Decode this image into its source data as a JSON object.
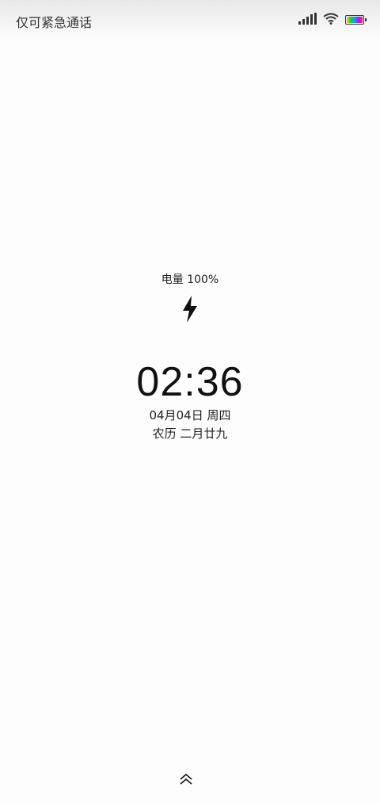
{
  "status_bar": {
    "carrier_text": "仅可紧急通话",
    "icons": [
      "signal-icon",
      "wifi-icon",
      "battery-icon"
    ]
  },
  "lock_screen": {
    "charge_text": "电量 100%",
    "charging_icon": "lightning-bolt-icon",
    "time": "02:36",
    "date": "04月04日 周四",
    "lunar_date": "农历 二月廿九",
    "unlock_hint_icon": "double-chevron-up-icon"
  }
}
